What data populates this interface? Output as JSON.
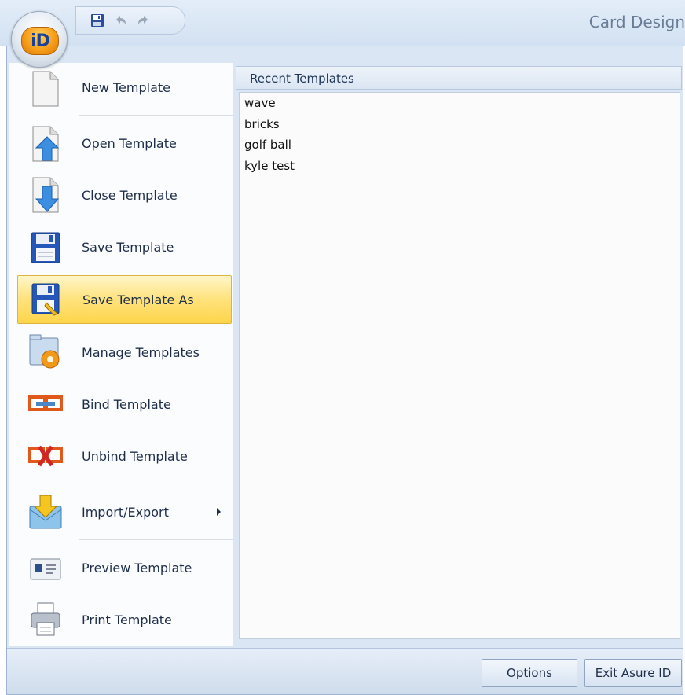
{
  "window": {
    "title": "Card Design"
  },
  "quick_access": {
    "save": "save-icon",
    "undo": "undo-icon",
    "redo": "redo-icon"
  },
  "app_button": {
    "logo_text": "iD"
  },
  "menu": {
    "items": [
      {
        "label": "New Template",
        "icon": "new-document-icon"
      },
      {
        "label": "Open Template",
        "icon": "open-template-icon"
      },
      {
        "label": "Close Template",
        "icon": "close-template-icon"
      },
      {
        "label": "Save Template",
        "icon": "save-icon"
      },
      {
        "label": "Save Template As",
        "icon": "save-as-icon",
        "highlighted": true
      },
      {
        "label": "Manage Templates",
        "icon": "manage-templates-icon"
      },
      {
        "label": "Bind Template",
        "icon": "bind-icon"
      },
      {
        "label": "Unbind Template",
        "icon": "unbind-icon"
      },
      {
        "label": "Import/Export",
        "icon": "import-export-icon",
        "submenu": true
      },
      {
        "label": "Preview Template",
        "icon": "preview-icon"
      },
      {
        "label": "Print Template",
        "icon": "printer-icon"
      }
    ]
  },
  "recent": {
    "header": "Recent Templates",
    "items": [
      "wave",
      "bricks",
      "golf ball",
      "kyle test"
    ]
  },
  "footer": {
    "options_label": "Options",
    "exit_label": "Exit Asure ID"
  },
  "colors": {
    "accent": "#ffd84a",
    "frame": "#dae6f4",
    "border": "#9fb4d0"
  }
}
